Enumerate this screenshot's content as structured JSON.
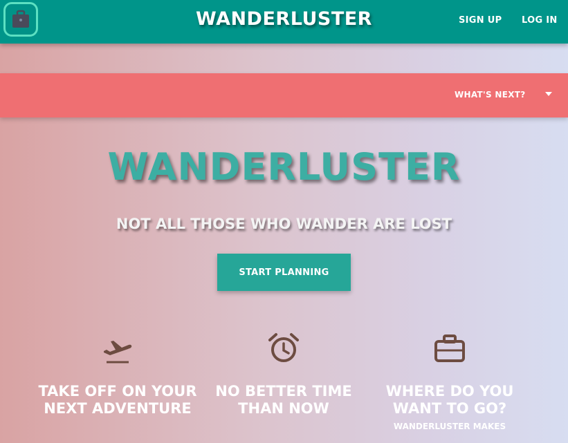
{
  "navbar": {
    "logo_icon": "suitcase-icon",
    "brand": "WANDERLUSTER",
    "signup": "SIGN UP",
    "login": "LOG IN",
    "bg_color": "#00958a"
  },
  "subbar": {
    "dropdown_label": "WHAT'S NEXT?",
    "bg_color": "#ef6f72"
  },
  "hero": {
    "title": "WANDERLUSTER",
    "tagline": "NOT ALL THOSE WHO WANDER ARE LOST",
    "cta": "START PLANNING",
    "title_color": "#3daea3"
  },
  "features": [
    {
      "icon": "flight-takeoff-icon",
      "title": "TAKE OFF ON YOUR NEXT ADVENTURE"
    },
    {
      "icon": "alarm-clock-icon",
      "title": "NO BETTER TIME THAN NOW"
    },
    {
      "icon": "briefcase-icon",
      "title": "WHERE DO YOU WANT TO GO?",
      "text": "WANDERLUSTER MAKES"
    }
  ]
}
